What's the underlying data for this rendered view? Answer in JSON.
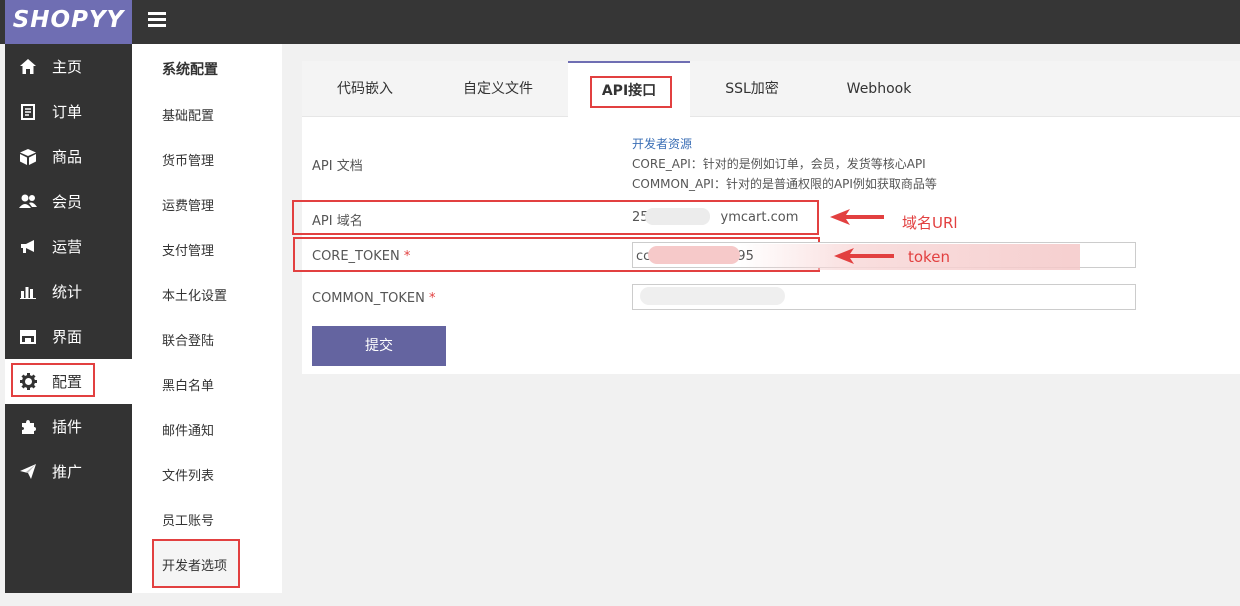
{
  "app": {
    "logo": "SHOPYY"
  },
  "sidebar": {
    "items": [
      {
        "label": "主页",
        "icon": "home-icon"
      },
      {
        "label": "订单",
        "icon": "order-icon"
      },
      {
        "label": "商品",
        "icon": "box-icon"
      },
      {
        "label": "会员",
        "icon": "users-icon"
      },
      {
        "label": "运营",
        "icon": "megaphone-icon"
      },
      {
        "label": "统计",
        "icon": "bar-chart-icon"
      },
      {
        "label": "界面",
        "icon": "storefront-icon"
      },
      {
        "label": "配置",
        "icon": "gear-icon",
        "active": true
      },
      {
        "label": "插件",
        "icon": "puzzle-icon"
      },
      {
        "label": "推广",
        "icon": "send-icon"
      }
    ]
  },
  "submenu": {
    "title": "系统配置",
    "items": [
      "基础配置",
      "货币管理",
      "运费管理",
      "支付管理",
      "本土化设置",
      "联合登陆",
      "黑白名单",
      "邮件通知",
      "文件列表",
      "员工账号",
      "开发者选项"
    ],
    "active": "开发者选项"
  },
  "tabs": [
    "代码嵌入",
    "自定义文件",
    "API接口",
    "SSL加密",
    "Webhook"
  ],
  "active_tab": "API接口",
  "form": {
    "api_doc_label": "API 文档",
    "dev_link": "开发者资源",
    "core_api_desc": "CORE_API：针对的是例如订单，会员，发货等核心API",
    "common_api_desc": "COMMON_API：针对的是普通权限的API例如获取商品等",
    "domain_label": "API 域名",
    "domain_value_prefix": "25",
    "domain_value_suffix": "ymcart.com",
    "core_token_label": "CORE_TOKEN",
    "core_token_value_prefix": "cc",
    "core_token_value_suffix": "95",
    "common_token_label": "COMMON_TOKEN",
    "required_mark": "*",
    "submit": "提交"
  },
  "annotations": {
    "domain": "域名URl",
    "token": "token"
  },
  "colors": {
    "accent": "#6f6eb3",
    "highlight": "#e24040",
    "submit": "#6464a0"
  }
}
